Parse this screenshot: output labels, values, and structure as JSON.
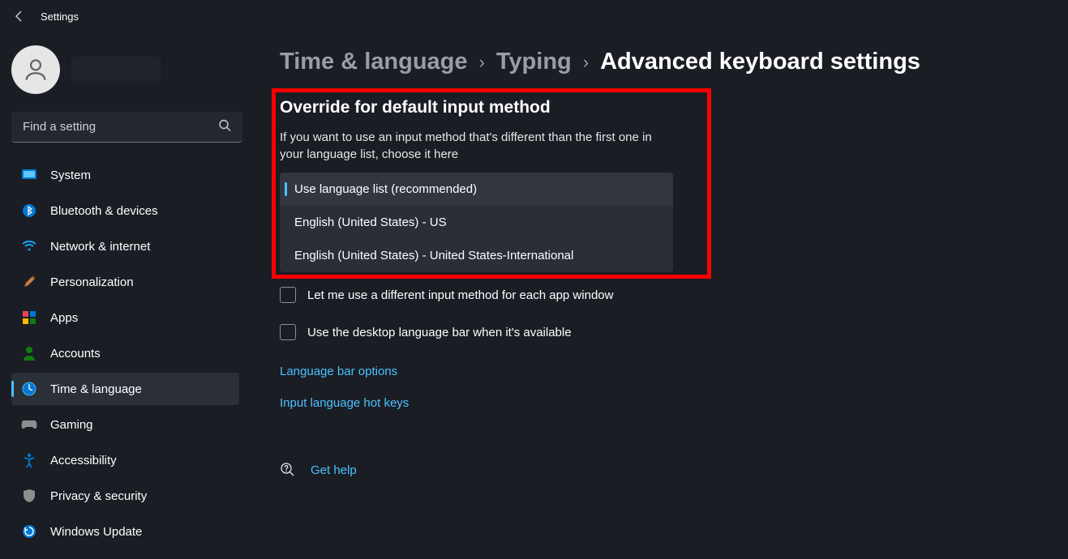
{
  "window_title": "Settings",
  "search": {
    "placeholder": "Find a setting"
  },
  "sidebar": {
    "items": [
      {
        "label": "System"
      },
      {
        "label": "Bluetooth & devices"
      },
      {
        "label": "Network & internet"
      },
      {
        "label": "Personalization"
      },
      {
        "label": "Apps"
      },
      {
        "label": "Accounts"
      },
      {
        "label": "Time & language"
      },
      {
        "label": "Gaming"
      },
      {
        "label": "Accessibility"
      },
      {
        "label": "Privacy & security"
      },
      {
        "label": "Windows Update"
      }
    ]
  },
  "breadcrumb": {
    "level1": "Time & language",
    "level2": "Typing",
    "level3": "Advanced keyboard settings"
  },
  "override_section": {
    "title": "Override for default input method",
    "desc": "If you want to use an input method that's different than the first one in your language list, choose it here",
    "options": [
      "Use language list (recommended)",
      "English (United States) - US",
      "English (United States) - United States-International"
    ]
  },
  "checkboxes": {
    "per_app": "Let me use a different input method for each app window",
    "desktop_bar": "Use the desktop language bar when it's available"
  },
  "links": {
    "language_bar": "Language bar options",
    "hot_keys": "Input language hot keys",
    "get_help": "Get help"
  }
}
